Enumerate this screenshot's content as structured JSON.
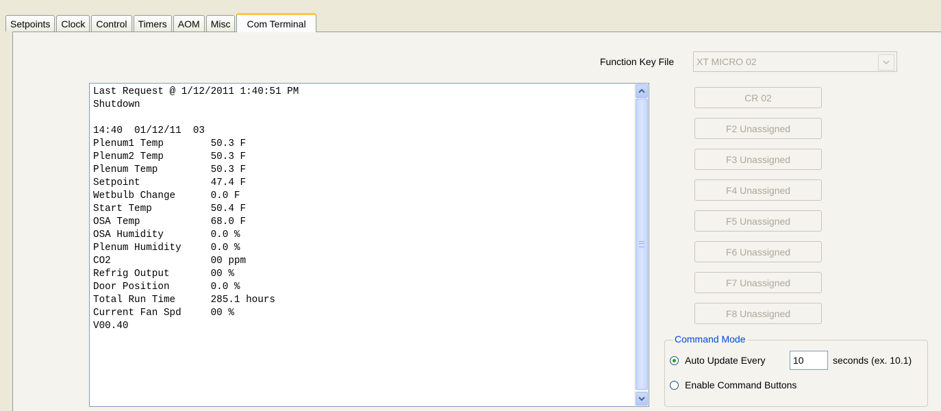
{
  "tabs": [
    "Setpoints",
    "Clock",
    "Control",
    "Timers",
    "AOM",
    "Misc",
    "Com Terminal"
  ],
  "active_tab": "Com Terminal",
  "function_key_file": {
    "label": "Function Key File",
    "value": "XT MICRO 02"
  },
  "terminal": {
    "lines": [
      "Last Request @ 1/12/2011 1:40:51 PM",
      "Shutdown",
      "",
      "14:40  01/12/11  03",
      "Plenum1 Temp        50.3 F",
      "Plenum2 Temp        50.3 F",
      "Plenum Temp         50.3 F",
      "Setpoint            47.4 F",
      "Wetbulb Change      0.0 F",
      "Start Temp          50.4 F",
      "OSA Temp            68.0 F",
      "OSA Humidity        0.0 %",
      "Plenum Humidity     0.0 %",
      "CO2                 00 ppm",
      "Refrig Output       00 %",
      "Door Position       0.0 %",
      "Total Run Time      285.1 hours",
      "Current Fan Spd     00 %",
      "V00.40"
    ]
  },
  "function_buttons": [
    "CR 02",
    "F2 Unassigned",
    "F3 Unassigned",
    "F4 Unassigned",
    "F5 Unassigned",
    "F6 Unassigned",
    "F7 Unassigned",
    "F8 Unassigned"
  ],
  "command_mode": {
    "title": "Command Mode",
    "auto_update_label": "Auto Update Every",
    "interval_value": "10",
    "interval_suffix": "seconds (ex. 10.1)",
    "enable_buttons_label": "Enable Command Buttons",
    "selected": "auto_update"
  },
  "colors": {
    "background": "#ece9d8",
    "panel": "#f4f3ee",
    "active_tab_accent": "#ffc83c",
    "group_title": "#0046d5",
    "disabled_text": "#aca899"
  }
}
